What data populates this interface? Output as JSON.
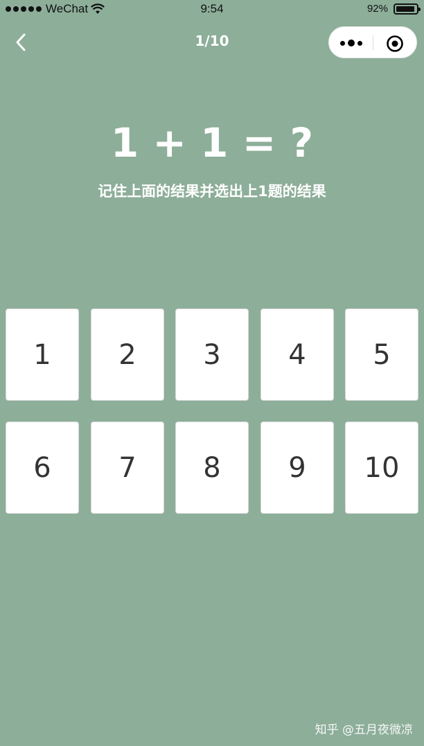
{
  "status_bar": {
    "carrier": "WeChat",
    "time": "9:54",
    "battery": "92%",
    "battery_level": 0.92
  },
  "nav": {
    "title": "1/10",
    "back_icon": "chevron-left-icon",
    "more_icon": "more-dots-icon",
    "close_icon": "record-target-icon"
  },
  "question": {
    "expression": "1 + 1 = ?",
    "instruction": "记住上面的结果并选出上1题的结果"
  },
  "options": [
    "1",
    "2",
    "3",
    "4",
    "5",
    "6",
    "7",
    "8",
    "9",
    "10"
  ],
  "watermark": "知乎 @五月夜微凉",
  "colors": {
    "background": "#8dae99",
    "card": "#ffffff",
    "card_text": "#333333"
  }
}
